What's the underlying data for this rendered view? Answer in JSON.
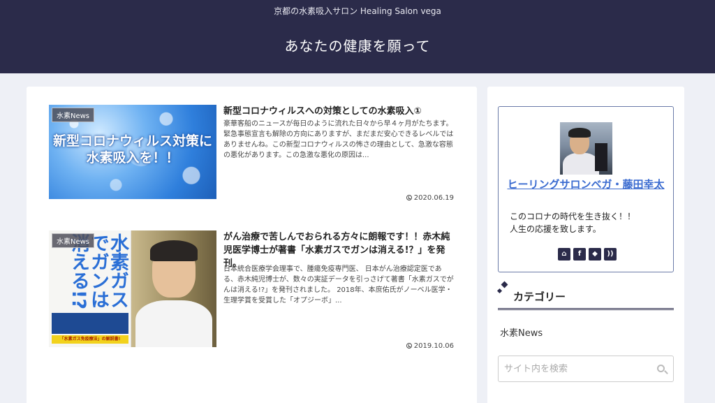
{
  "header": {
    "tagline": "京都の水素吸入サロン Healing Salon vega",
    "title": "あなたの健康を願って"
  },
  "posts": [
    {
      "category": "水素News",
      "thumb_text": "新型コロナウィルス対策に 水素吸入を！！",
      "title": "新型コロナウィルスへの対策としての水素吸入①",
      "snippet": "豪華客船のニュースが毎日のように流れた日々から早４ヶ月がたちます。緊急事態宣言も解除の方向にありますが、まだまだ安心できるレベルではありませんね。この新型コロナウィルスの怖さの理由として、急激な容態の悪化があります。この急激な悪化の原因は...",
      "date": "2020.06.19"
    },
    {
      "category": "水素News",
      "book_title_a": "水素ガスで",
      "book_title_b": "ガンは消える!?",
      "book_band": "「水素ガス免疫療法」の解説書!",
      "title": "がん治療で苦しんでおられる方々に朗報です！！赤木純児医学博士が著書「水素ガスでガンは消える!？」を発刊。",
      "snippet": "日本統合医療学会理事で、腫瘍免疫専門医、 日本がん治療認定医である、赤木純児博士が、数々の実証データを引っさげて著書「水素ガスでがんは消える!?」を発刊されました。 2018年、本庶佑氏がノーベル医学・生理学賞を受賞した「オプジーボ」...",
      "date": "2019.10.06"
    }
  ],
  "sidebar": {
    "profile_name": "ヒーリングサロンベガ・藤田幸太",
    "profile_desc_line1": "このコロナの時代を生き抜く！！",
    "profile_desc_line2": "人生の応援を致します。",
    "socials": [
      "home-icon",
      "facebook-icon",
      "feedly-icon",
      "rss-icon"
    ],
    "category_heading": "カテゴリー",
    "category_item": "水素News",
    "search_placeholder": "サイト内を検索"
  },
  "colors": {
    "header_bg": "#2b2b4a",
    "link": "#3a6bd0",
    "page_bg": "#eef0f6"
  }
}
